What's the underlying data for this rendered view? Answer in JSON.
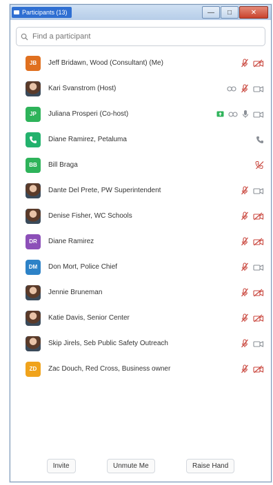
{
  "window": {
    "title": "Participants (13)"
  },
  "search": {
    "placeholder": "Find a participant"
  },
  "participants": [
    {
      "name": "Jeff Bridawn, Wood (Consultant) (Me)",
      "initials": "JB",
      "avatar_color": "#e0701f",
      "audio": "muted",
      "video": "off"
    },
    {
      "name": "Kari Svanstrom (Host)",
      "initials": "",
      "avatar_color": "",
      "audio": "muted",
      "video": "on",
      "share": true
    },
    {
      "name": "Juliana Prosperi (Co-host)",
      "initials": "JP",
      "avatar_color": "#2eb35a",
      "audio": "on",
      "video": "on",
      "share": true,
      "badge": true
    },
    {
      "name": "Diane Ramirez, Petaluma",
      "initials": "",
      "avatar_color": "#23b26d",
      "audio": "phone",
      "video": "none",
      "phone": true
    },
    {
      "name": "Bill Braga",
      "initials": "BB",
      "avatar_color": "#2eb35a",
      "audio": "phone-muted",
      "video": "none"
    },
    {
      "name": "Dante Del Prete, PW Superintendent",
      "initials": "",
      "avatar_color": "",
      "audio": "muted",
      "video": "on"
    },
    {
      "name": "Denise Fisher, WC Schools",
      "initials": "",
      "avatar_color": "",
      "audio": "muted",
      "video": "off"
    },
    {
      "name": "Diane Ramirez",
      "initials": "DR",
      "avatar_color": "#8c4fb8",
      "audio": "muted",
      "video": "off"
    },
    {
      "name": "Don Mort, Police Chief",
      "initials": "DM",
      "avatar_color": "#2d82c7",
      "audio": "muted",
      "video": "on"
    },
    {
      "name": "Jennie Bruneman",
      "initials": "",
      "avatar_color": "",
      "audio": "muted",
      "video": "off"
    },
    {
      "name": "Katie Davis, Senior Center",
      "initials": "",
      "avatar_color": "",
      "audio": "muted",
      "video": "off"
    },
    {
      "name": "Skip Jirels, Seb Public Safety Outreach",
      "initials": "",
      "avatar_color": "",
      "audio": "muted",
      "video": "on"
    },
    {
      "name": "Zac Douch, Red Cross, Business owner",
      "initials": "ZD",
      "avatar_color": "#f0a31c",
      "audio": "muted",
      "video": "off"
    }
  ],
  "footer": {
    "invite": "Invite",
    "unmute": "Unmute Me",
    "raise_hand": "Raise Hand"
  },
  "colors": {
    "muted_red": "#c9463d",
    "icon_gray": "#8a8f96",
    "share_green": "#2eb35a"
  }
}
